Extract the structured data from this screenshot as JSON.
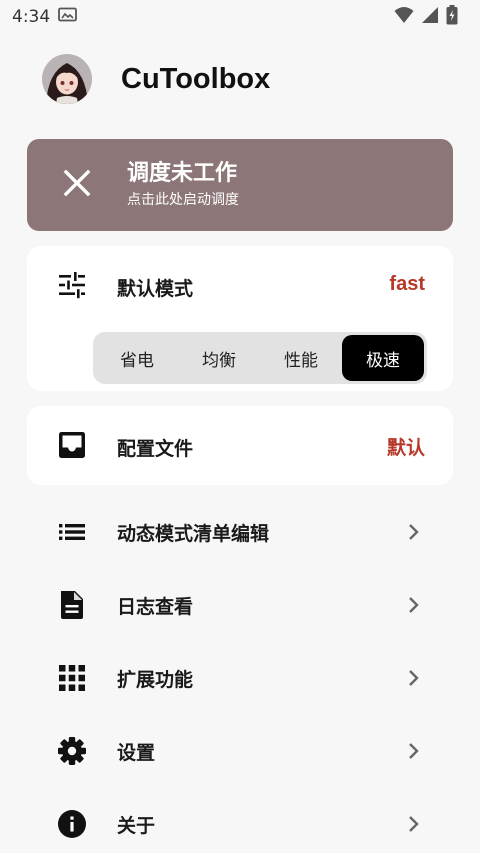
{
  "status_bar": {
    "time": "4:34"
  },
  "header": {
    "app_title": "CuToolbox"
  },
  "scheduler_status": {
    "title": "调度未工作",
    "subtitle": "点击此处启动调度",
    "icon": "close-icon",
    "color": "#8d7677"
  },
  "default_mode": {
    "label": "默认模式",
    "value": "fast",
    "icon": "tune-sliders-icon",
    "options": [
      "省电",
      "均衡",
      "性能",
      "极速"
    ],
    "selected": "极速"
  },
  "config_file": {
    "label": "配置文件",
    "value": "默认",
    "icon": "inbox-tray-icon"
  },
  "menu": {
    "items": [
      {
        "label": "动态模式清单编辑",
        "icon": "list-icon"
      },
      {
        "label": "日志查看",
        "icon": "document-icon"
      },
      {
        "label": "扩展功能",
        "icon": "apps-grid-icon"
      },
      {
        "label": "设置",
        "icon": "gear-icon"
      },
      {
        "label": "关于",
        "icon": "info-icon"
      }
    ]
  },
  "colors": {
    "accent_value": "#b7392a",
    "selected_segment": "#000000",
    "background": "#f7f7f7"
  }
}
